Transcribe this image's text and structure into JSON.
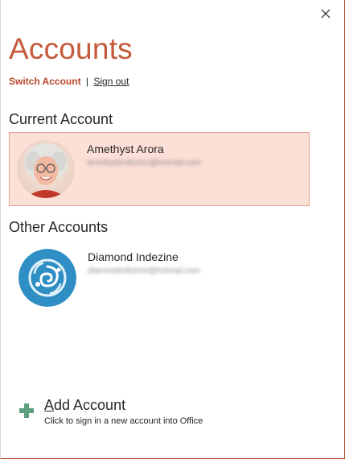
{
  "dialog": {
    "title": "Accounts",
    "close_icon": "close-icon"
  },
  "links": {
    "switch_account": "Switch Account",
    "separator": "|",
    "sign_out": "Sign out"
  },
  "current_account": {
    "heading": "Current Account",
    "name": "Amethyst Arora",
    "email": "amethystindezine@hotmail.com",
    "avatar_icon": "user-photo-avatar"
  },
  "other_accounts": {
    "heading": "Other Accounts",
    "items": [
      {
        "name": "Diamond Indezine",
        "email": "diamondindezine@hotmail.com",
        "avatar_icon": "swirl-logo-avatar"
      }
    ]
  },
  "add_account": {
    "label_first_letter": "A",
    "label_rest": "dd Account",
    "description": "Click to sign in a new account into Office",
    "icon": "plus-icon"
  },
  "colors": {
    "accent": "#c55a3a",
    "link_accent": "#b7472a",
    "selected_bg": "#fcdfd6",
    "selected_border": "#e7a18f",
    "avatar_blue": "#2f8fc4",
    "plus_green": "#5d9e7f"
  }
}
